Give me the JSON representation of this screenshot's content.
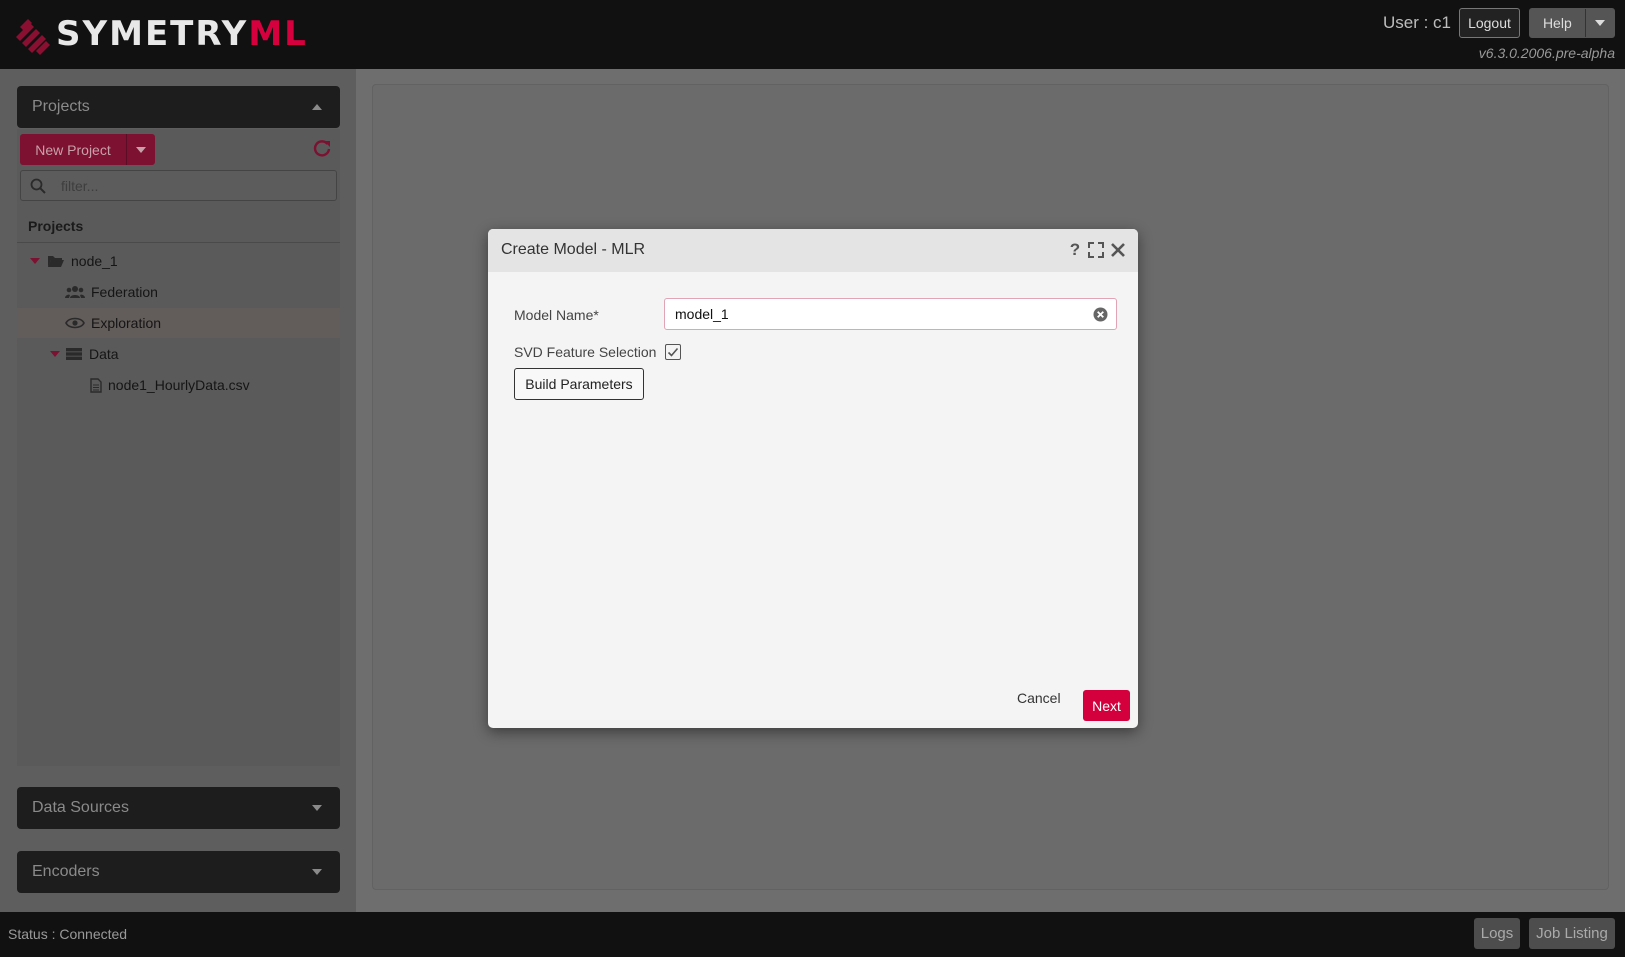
{
  "header": {
    "logo_main": "SYMETRY",
    "logo_accent": "ML",
    "user_label": "User : c1",
    "logout_label": "Logout",
    "help_label": "Help",
    "version": "v6.3.0.2006.pre-alpha"
  },
  "sidebar": {
    "projects_panel_title": "Projects",
    "new_project_label": "New Project",
    "filter_placeholder": "filter...",
    "tree_title": "Projects",
    "tree": {
      "node": "node_1",
      "federation": "Federation",
      "exploration": "Exploration",
      "data": "Data",
      "file": "node1_HourlyData.csv"
    },
    "data_sources_title": "Data Sources",
    "encoders_title": "Encoders"
  },
  "footer": {
    "status": "Status : Connected",
    "logs_label": "Logs",
    "job_listing_label": "Job Listing"
  },
  "modal": {
    "title": "Create Model - MLR",
    "model_name_label": "Model Name*",
    "model_name_value": "model_1",
    "svd_label": "SVD Feature Selection",
    "svd_checked": true,
    "build_parameters_label": "Build Parameters",
    "cancel_label": "Cancel",
    "next_label": "Next"
  },
  "colors": {
    "brand": "#d6003f",
    "header_bg": "#111111",
    "overlay_bg": "#6e6e6e",
    "modal_bg": "#f4f4f4"
  }
}
